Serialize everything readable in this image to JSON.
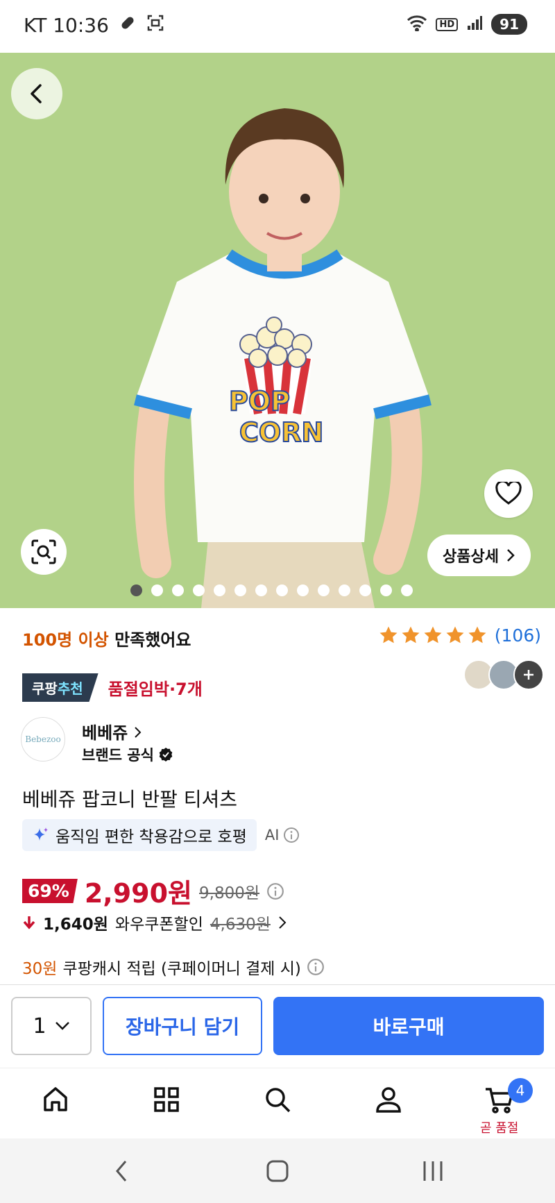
{
  "status_bar": {
    "carrier_time": "KT 10:36",
    "network": "6",
    "hd": "HD",
    "battery": "91"
  },
  "hero": {
    "detail_button": "상품상세",
    "image_count": 14,
    "active_image": 1,
    "colors": {
      "background": "#b2d289"
    }
  },
  "satisfaction": {
    "highlight": "100명 이상",
    "text": "만족했어요"
  },
  "rating": {
    "stars": 5,
    "count": "(106)"
  },
  "badges": {
    "rec_prefix": "쿠팡",
    "rec_suffix": "추천",
    "stock": "품절임박·7개"
  },
  "brand": {
    "logo_text": "Bebezoo",
    "name": "베베쥬",
    "official": "브랜드 공식"
  },
  "product": {
    "title": "베베쥬 팝코니 반팔 티셔츠",
    "ai_summary": "움직임 편한 착용감으로 호평",
    "ai_label": "AI"
  },
  "price": {
    "discount": "69%",
    "sale": "2,990원",
    "original": "9,800원",
    "coupon_amount": "1,640원",
    "coupon_label": "와우쿠폰할인",
    "coupon_before": "4,630원",
    "cash_amount": "30원",
    "cash_text": "쿠팡캐시 적립 (쿠페이머니 결제 시)"
  },
  "actions": {
    "quantity": "1",
    "cart": "장바구니 담기",
    "buy": "바로구매"
  },
  "bottom_nav": {
    "cart_count": "4",
    "cart_label": "곧 품절"
  },
  "colors": {
    "accent": "#3373f5",
    "sale_red": "#c8102e",
    "rating_orange": "#f0932b"
  }
}
